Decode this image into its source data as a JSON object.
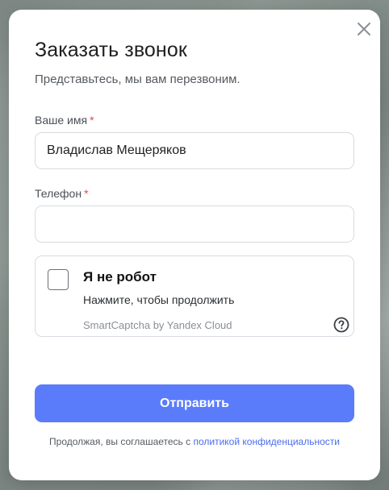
{
  "modal": {
    "title": "Заказать звонок",
    "subtitle": "Представьтесь, мы вам перезвоним."
  },
  "form": {
    "name": {
      "label": "Ваше имя",
      "required_mark": "*",
      "value": "Владислав Мещеряков"
    },
    "phone": {
      "label": "Телефон",
      "required_mark": "*",
      "value": ""
    },
    "submit_label": "Отправить"
  },
  "captcha": {
    "checked": false,
    "title": "Я не робот",
    "hint": "Нажмите, чтобы продолжить",
    "brand": "SmartCaptcha by Yandex Cloud",
    "help_icon": "question-circle-icon"
  },
  "consent": {
    "text": "Продолжая, вы соглашаетесь с",
    "link_text": "политикой конфиденциальности"
  },
  "icons": {
    "close": "close-icon"
  },
  "colors": {
    "accent": "#5b7cfa",
    "link": "#4a6cf0",
    "required": "#e5484d",
    "border": "#d8dbe0"
  }
}
